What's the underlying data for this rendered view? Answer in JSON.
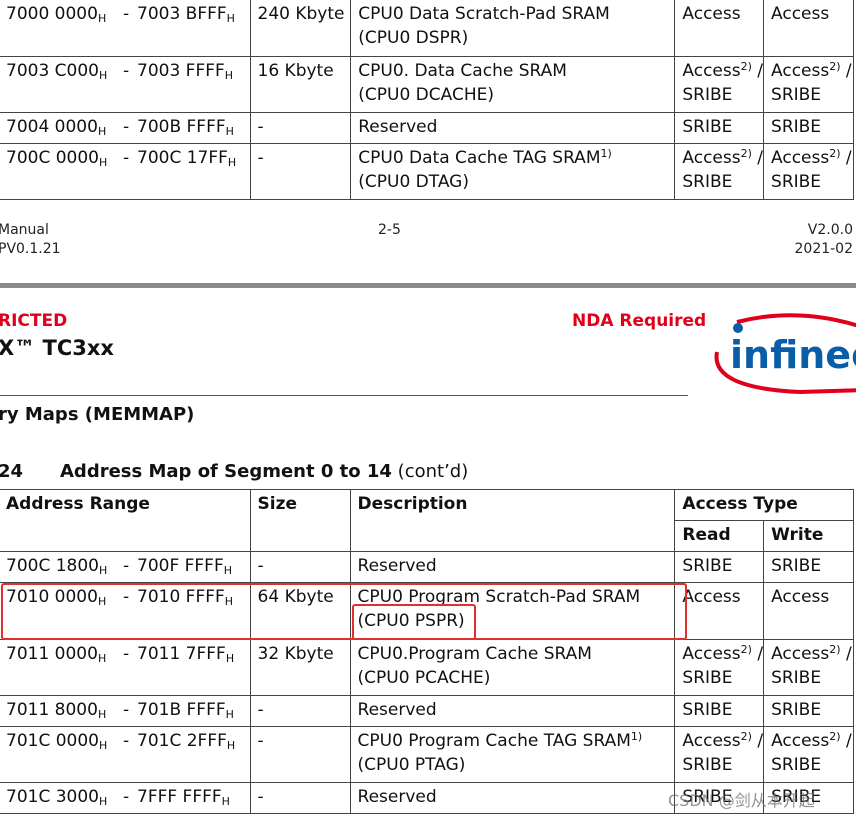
{
  "top_rows": [
    {
      "from": "7000 0000",
      "to": "7003 BFFF",
      "size": "240 Kbyte",
      "desc": [
        "CPU0 Data Scratch-Pad SRAM",
        "(CPU0 DSPR)"
      ],
      "desc_sup": "",
      "read": "Access",
      "read_sup": "",
      "read2": "",
      "write": "Access",
      "write_sup": "",
      "write2": ""
    },
    {
      "from": "7003 C000",
      "to": "7003 FFFF",
      "size": "16 Kbyte",
      "desc": [
        "CPU0. Data Cache SRAM",
        "(CPU0 DCACHE)"
      ],
      "desc_sup": "",
      "read": "Access",
      "read_sup": "2)",
      "read2": "SRIBE",
      "write": "Access",
      "write_sup": "2)",
      "write2": "SRIBE"
    },
    {
      "from": "7004 0000",
      "to": "700B FFFF",
      "size": "-",
      "desc": [
        "Reserved"
      ],
      "desc_sup": "",
      "read": "SRIBE",
      "read_sup": "",
      "read2": "",
      "write": "SRIBE",
      "write_sup": "",
      "write2": ""
    },
    {
      "from": "700C 0000",
      "to": "700C 17FF",
      "size": "-",
      "desc": [
        "CPU0 Data Cache TAG SRAM",
        "(CPU0 DTAG)"
      ],
      "desc_sup": "1)",
      "read": "Access",
      "read_sup": "2)",
      "read2": "SRIBE",
      "write": "Access",
      "write_sup": "2)",
      "write2": "SRIBE"
    }
  ],
  "footer": {
    "left1": "Manual",
    "left2": "PV0.1.21",
    "center": "2-5",
    "right1": "V2.0.0",
    "right2": "2021-02"
  },
  "header": {
    "restricted": "RICTED",
    "nda": "NDA Required",
    "product": "X™ TC3xx",
    "chapter": "ry Maps (MEMMAP)",
    "table_num": "24",
    "table_title": "Address Map of Segment 0 to 14",
    "table_cont": "(cont’d)",
    "logo_text": "infineo"
  },
  "columns": {
    "address": "Address Range",
    "size": "Size",
    "desc": "Description",
    "access": "Access Type",
    "read": "Read",
    "write": "Write"
  },
  "hex_suffix": "H",
  "dash": "-",
  "bottom_rows": [
    {
      "from": "700C 1800",
      "to": "700F FFFF",
      "size": "-",
      "desc": [
        "Reserved"
      ],
      "desc_sup": "",
      "read": "SRIBE",
      "read_sup": "",
      "read2": "",
      "write": "SRIBE",
      "write_sup": "",
      "write2": ""
    },
    {
      "from": "7010 0000",
      "to": "7010 FFFF",
      "size": "64 Kbyte",
      "desc": [
        "CPU0 Program Scratch-Pad SRAM",
        "(CPU0 PSPR)"
      ],
      "desc_sup": "",
      "read": "Access",
      "read_sup": "",
      "read2": "",
      "write": "Access",
      "write_sup": "",
      "write2": ""
    },
    {
      "from": "7011 0000",
      "to": "7011 7FFF",
      "size": "32 Kbyte",
      "desc": [
        "CPU0.Program Cache SRAM",
        "(CPU0 PCACHE)"
      ],
      "desc_sup": "",
      "read": "Access",
      "read_sup": "2)",
      "read2": "SRIBE",
      "write": "Access",
      "write_sup": "2)",
      "write2": "SRIBE"
    },
    {
      "from": "7011 8000",
      "to": "701B FFFF",
      "size": "-",
      "desc": [
        "Reserved"
      ],
      "desc_sup": "",
      "read": "SRIBE",
      "read_sup": "",
      "read2": "",
      "write": "SRIBE",
      "write_sup": "",
      "write2": ""
    },
    {
      "from": "701C 0000",
      "to": "701C 2FFF",
      "size": "-",
      "desc": [
        "CPU0 Program Cache TAG SRAM",
        "(CPU0 PTAG)"
      ],
      "desc_sup": "1)",
      "read": "Access",
      "read_sup": "2)",
      "read2": "SRIBE",
      "write": "Access",
      "write_sup": "2)",
      "write2": "SRIBE"
    },
    {
      "from": "701C 3000",
      "to": "7FFF FFFF",
      "size": "-",
      "desc": [
        "Reserved"
      ],
      "desc_sup": "",
      "read": "SRIBE",
      "read_sup": "",
      "read2": "",
      "write": "SRIBE",
      "write_sup": "",
      "write2": ""
    }
  ],
  "watermark": "CSDN @剑从本开起",
  "colors": {
    "nda_red": "#e0001b",
    "highlight_box": "#e03030",
    "logo_blue": "#0a5ea8"
  }
}
